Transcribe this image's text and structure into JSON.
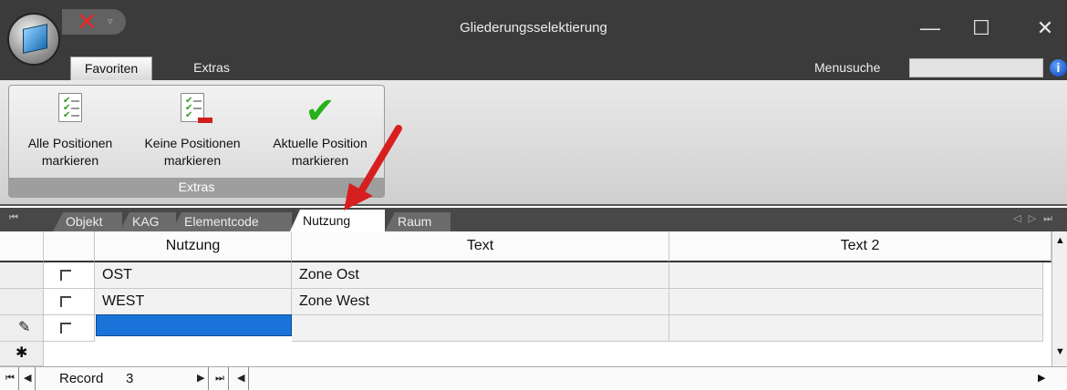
{
  "window": {
    "title": "Gliederungsselektierung",
    "minimize": "—",
    "maximize": "☐",
    "close": "✕"
  },
  "qat": {
    "close_glyph": "✕",
    "menu_glyph": "▿"
  },
  "ribbon_tabs": {
    "favoriten": "Favoriten",
    "extras": "Extras"
  },
  "menusuche": {
    "label": "Menusuche",
    "value": ""
  },
  "info_glyph": "i",
  "group": {
    "label": "Extras",
    "buttons": [
      {
        "line1": "Alle Positionen",
        "line2": "markieren",
        "icon": "select-all-icon"
      },
      {
        "line1": "Keine Positionen",
        "line2": "markieren",
        "icon": "deselect-all-icon"
      },
      {
        "line1": "Aktuelle Position",
        "line2": "markieren",
        "icon": "checkmark-icon"
      }
    ]
  },
  "object_tabs": [
    "Objekt",
    "KAG",
    "Elementcode",
    "Nutzung",
    "Raum"
  ],
  "active_tab": "Nutzung",
  "grid": {
    "columns": [
      "Nutzung",
      "Text",
      "Text 2"
    ],
    "rows": [
      {
        "nutzung": "OST",
        "text": "Zone Ost",
        "text2": ""
      },
      {
        "nutzung": "WEST",
        "text": "Zone West",
        "text2": ""
      }
    ],
    "edit_glyph": "✎",
    "new_glyph": "✱"
  },
  "record_bar": {
    "label": "Record",
    "current": "3"
  },
  "colors": {
    "titlebar": "#3b3b3b",
    "accent": "#1a73d8",
    "arrow": "#d71f1f",
    "check": "#27b21a"
  }
}
